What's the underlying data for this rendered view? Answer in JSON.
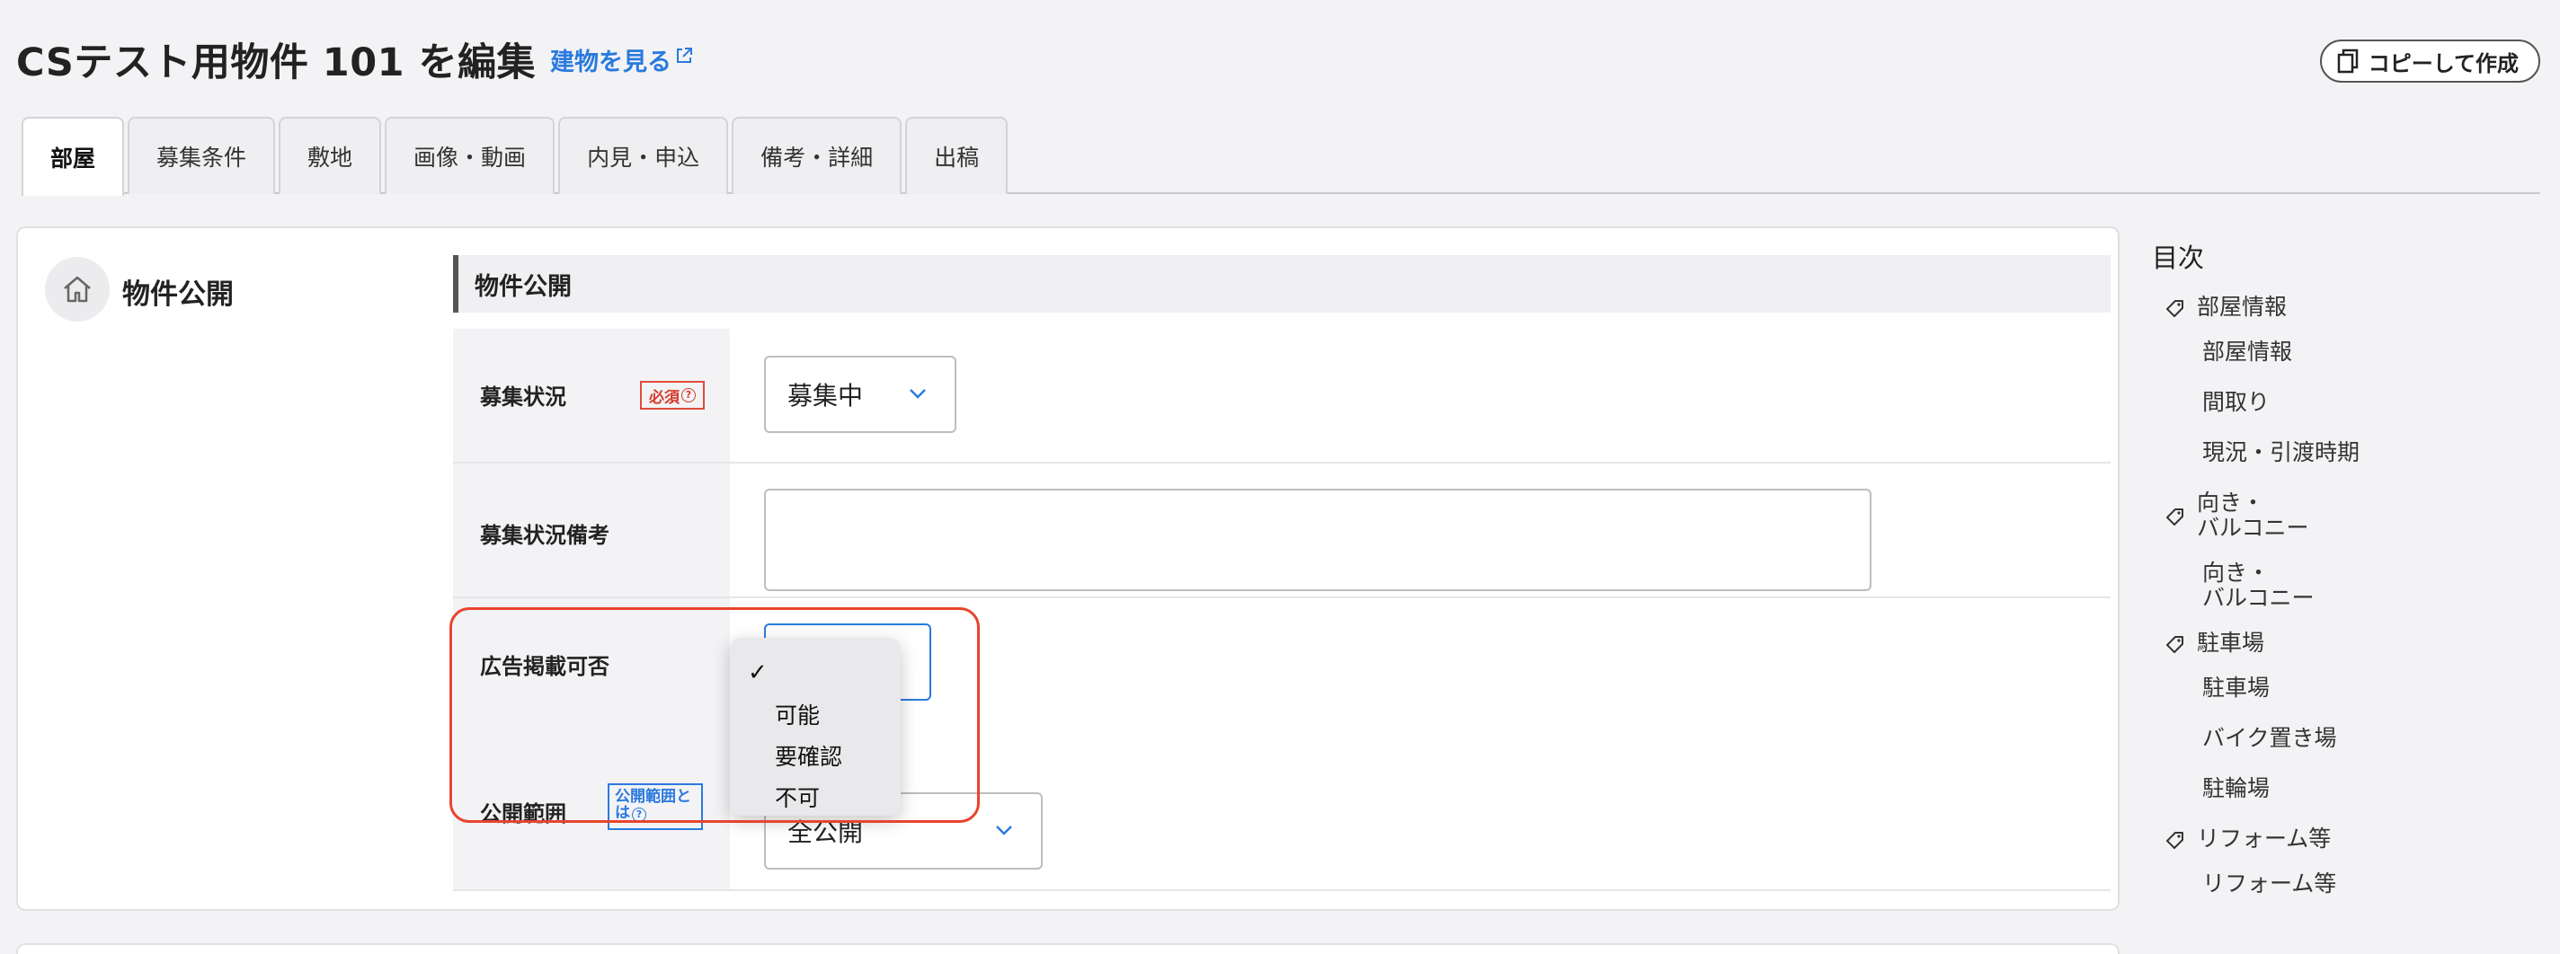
{
  "header": {
    "title": "CSテスト用物件 101 を編集",
    "view_link": "建物を見る",
    "copy_button": "コピーして作成"
  },
  "tabs": [
    {
      "label": "部屋",
      "active": true
    },
    {
      "label": "募集条件"
    },
    {
      "label": "敷地"
    },
    {
      "label": "画像・動画"
    },
    {
      "label": "内見・申込"
    },
    {
      "label": "備考・詳細"
    },
    {
      "label": "出稿"
    }
  ],
  "section": {
    "title": "物件公開",
    "subheading": "物件公開"
  },
  "form": {
    "status": {
      "label": "募集状況",
      "badge": "必須",
      "value": "募集中"
    },
    "status_note": {
      "label": "募集状況備考",
      "value": ""
    },
    "ad_permission": {
      "label": "広告掲載可否",
      "value": "",
      "options": [
        "",
        "可能",
        "要確認",
        "不可"
      ]
    },
    "visibility": {
      "label": "公開範囲",
      "badge": "公開範囲とは",
      "value": "全公開"
    }
  },
  "toc": {
    "title": "目次",
    "groups": [
      {
        "label": "部屋情報",
        "items": [
          "部屋情報",
          "間取り",
          "現況・引渡時期"
        ]
      },
      {
        "label": "向き・\nバルコニー",
        "items": [
          "向き・\nバルコニー"
        ]
      },
      {
        "label": "駐車場",
        "items": [
          "駐車場",
          "バイク置き場",
          "駐輪場"
        ]
      },
      {
        "label": "リフォーム等",
        "items": [
          "リフォーム等"
        ]
      }
    ]
  },
  "colors": {
    "accent": "#2a7ade",
    "required": "#d63b2c",
    "highlight": "#e8442e"
  }
}
